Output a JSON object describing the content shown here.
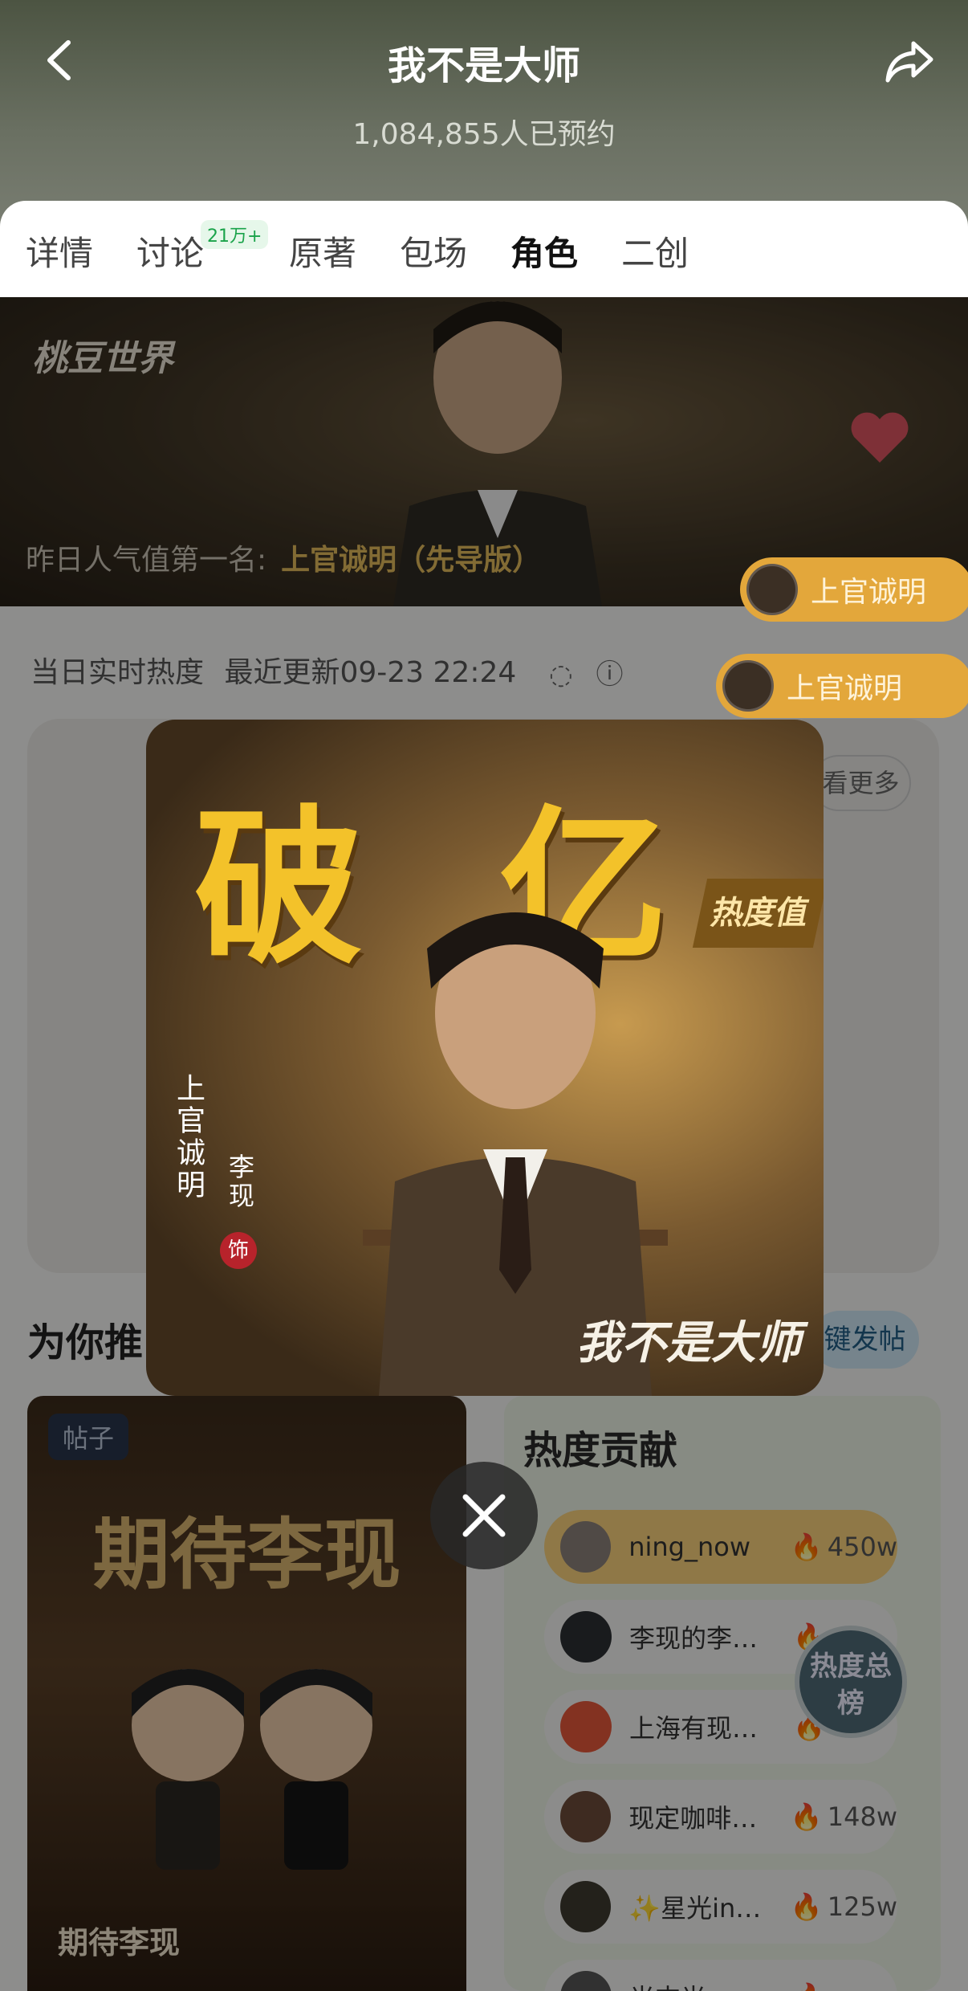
{
  "header": {
    "title": "我不是大师",
    "subtitle": "1,084,855人已预约"
  },
  "tabs": [
    {
      "label": "详情"
    },
    {
      "label": "讨论"
    },
    {
      "label": "原著"
    },
    {
      "label": "包场"
    },
    {
      "label": "角色"
    },
    {
      "label": "二创"
    }
  ],
  "tab_badge": "21万+",
  "active_tab": "角色",
  "banner": {
    "logo": "桃豆世界",
    "rank_label": "昨日人气值第一名:",
    "rank_name": "上官诚明（先导版）"
  },
  "float_pills": [
    {
      "label": "上官诚明"
    },
    {
      "label": "上官诚明"
    }
  ],
  "realtime": {
    "label": "当日实时热度",
    "updated": "最近更新09-23 22:24"
  },
  "more_label": "看更多",
  "section_title": "为你推",
  "post_button": "键发帖",
  "post_card": {
    "tag": "帖子",
    "title_big": "期待李现",
    "caption": "期待李现"
  },
  "heat": {
    "title": "热度贡献",
    "rows": [
      {
        "name": "ning_now",
        "value": "450w"
      },
      {
        "name": "李现的李…",
        "value": ""
      },
      {
        "name": "上海有现…",
        "value": ""
      },
      {
        "name": "现定咖啡…",
        "value": "148w"
      },
      {
        "name": "✨星光in…",
        "value": "125w"
      },
      {
        "name": "光杰光…",
        "value": ""
      }
    ],
    "board": "热度总榜"
  },
  "poster": {
    "big_left": "破",
    "big_right": "亿",
    "heat_label": "热度值",
    "role_name": "上官诚明",
    "actor": "李现",
    "seal": "饰",
    "sign": "我不是大师"
  },
  "colors": {
    "accent_gold": "#e3a73b",
    "heat_fire": "#e8542a",
    "badge_green": "#1aa34a"
  }
}
